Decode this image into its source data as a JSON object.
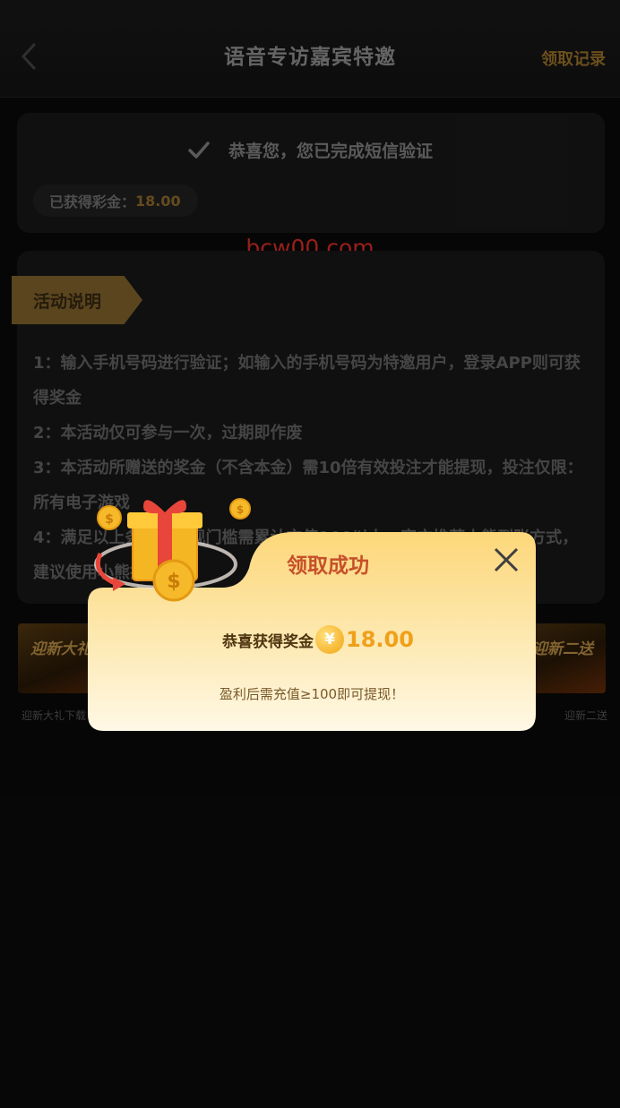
{
  "header": {
    "title": "语音专访嘉宾特邀",
    "records_link": "领取记录"
  },
  "verify_card": {
    "message": "恭喜您，您已完成短信验证",
    "bonus_label": "已获得彩金：",
    "bonus_amount": "18.00"
  },
  "watermark": "bcw00.com",
  "activity": {
    "tag": "活动说明",
    "rules": [
      "1：输入手机号码进行验证；如输入的手机号码为特邀用户，登录APP则可获得奖金",
      "2：本活动仅可参与一次，过期即作废",
      "3：本活动所赠送的奖金（不含本金）需10倍有效投注才能提现，投注仅限：所有电子游戏",
      "4：满足以上条件，提现门槛需累计充值100以上，官方推荐小熊到账方式，建议使用小熊提款"
    ]
  },
  "banners": [
    {
      "title": "迎新大礼",
      "label": "迎新大礼下载"
    },
    {
      "title": "迎新二送",
      "label": "迎新二送"
    }
  ],
  "modal": {
    "title": "领取成功",
    "reward_label": "恭喜获得奖金",
    "currency_symbol": "¥",
    "reward_amount": "18.00",
    "note": "盈利后需充值≥100即可提现！"
  },
  "colors": {
    "background": "#0a0a0a",
    "accent_gold": "#a77c2d",
    "watermark_red": "#e8302a",
    "modal_bg": "#fde7a0",
    "modal_title": "#c6502a"
  },
  "icons": [
    "back-icon",
    "check-icon",
    "close-icon",
    "yen-icon",
    "gift-icon"
  ]
}
